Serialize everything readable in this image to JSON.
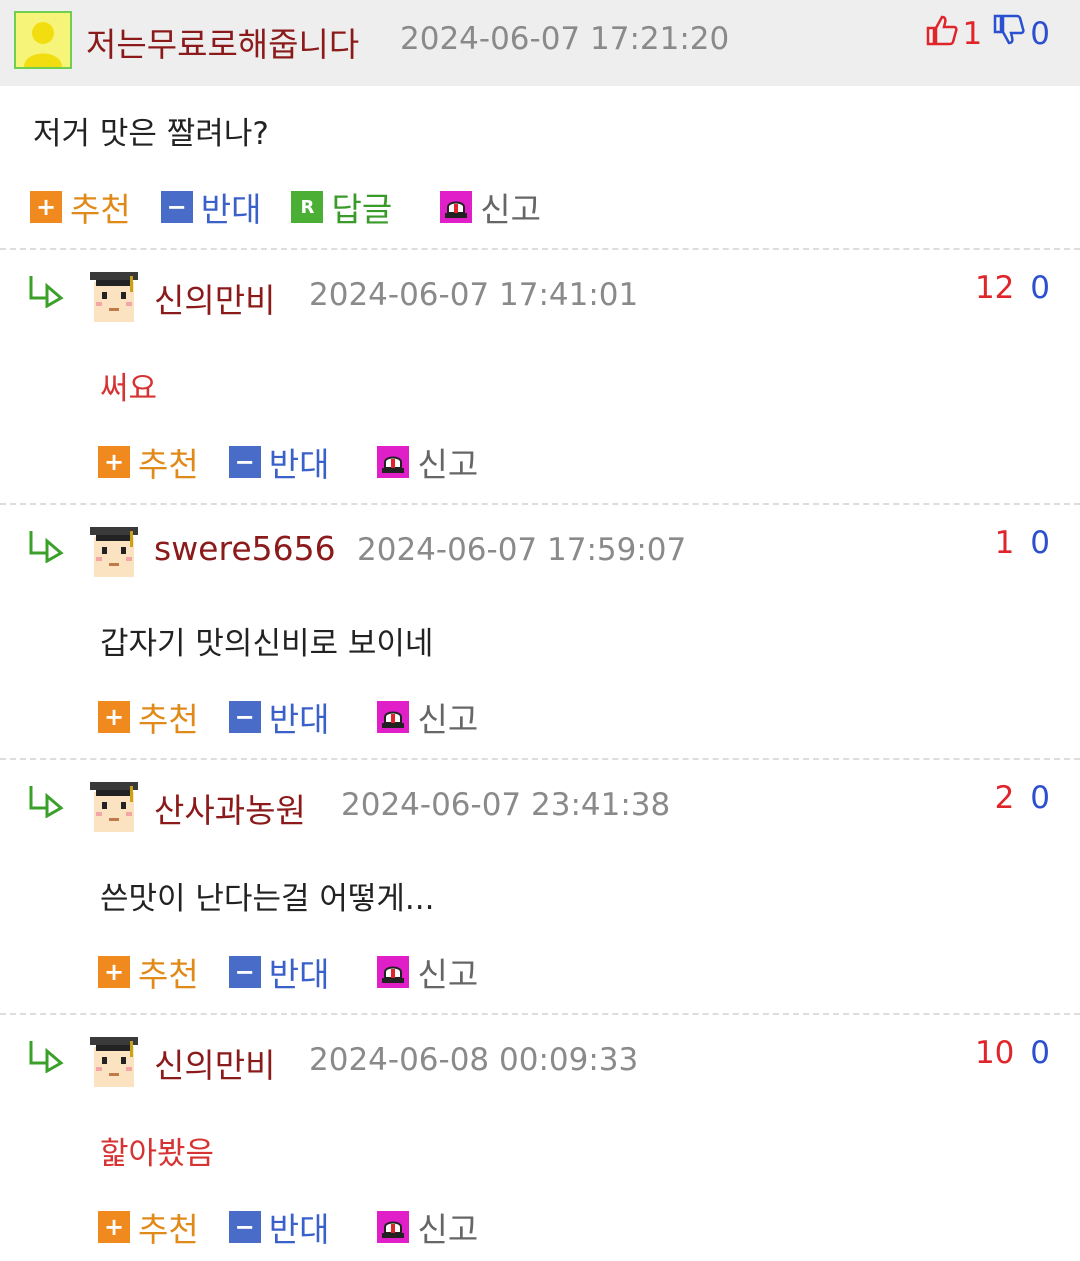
{
  "parent": {
    "author": "저는무료로해줍니다",
    "date": "2024-06-07 17:21:20",
    "upvotes": "1",
    "downvotes": "0",
    "body": "저거 맛은 짤려나?",
    "actions": {
      "recommend": "추천",
      "oppose": "반대",
      "reply": "답글",
      "report": "신고",
      "reply_icon_letter": "R"
    }
  },
  "replies": [
    {
      "author": "신의만비",
      "date": "2024-06-07 17:41:01",
      "upvotes": "12",
      "downvotes": "0",
      "body": "써요",
      "body_color": "red"
    },
    {
      "author": "swere5656",
      "date": "2024-06-07 17:59:07",
      "upvotes": "1",
      "downvotes": "0",
      "body": "갑자기 맛의신비로 보이네",
      "body_color": "dark"
    },
    {
      "author": "산사과농원",
      "date": "2024-06-07 23:41:38",
      "upvotes": "2",
      "downvotes": "0",
      "body": "쓴맛이 난다는걸 어떻게...",
      "body_color": "dark"
    },
    {
      "author": "신의만비",
      "date": "2024-06-08 00:09:33",
      "upvotes": "10",
      "downvotes": "0",
      "body": "핥아봤음",
      "body_color": "red"
    }
  ],
  "reply_actions": {
    "recommend": "추천",
    "oppose": "반대",
    "report": "신고"
  },
  "colors": {
    "author": "#8b1a1a",
    "date": "#8a8a8a",
    "recommend": "#f08a1e",
    "oppose": "#4a6cc9",
    "reply": "#4caf35",
    "report": "#e01fc8",
    "upvote": "#e0252a",
    "downvote": "#2a4fcf"
  },
  "icons": {
    "parent_avatar": "user-silhouette-icon",
    "reply_avatar": "graduate-cap-avatar-icon",
    "reply_marker": "reply-arrow-icon",
    "thumb_up": "thumbs-up-icon",
    "thumb_down": "thumbs-down-icon",
    "recommend": "plus-icon",
    "oppose": "minus-icon",
    "report": "siren-icon"
  }
}
